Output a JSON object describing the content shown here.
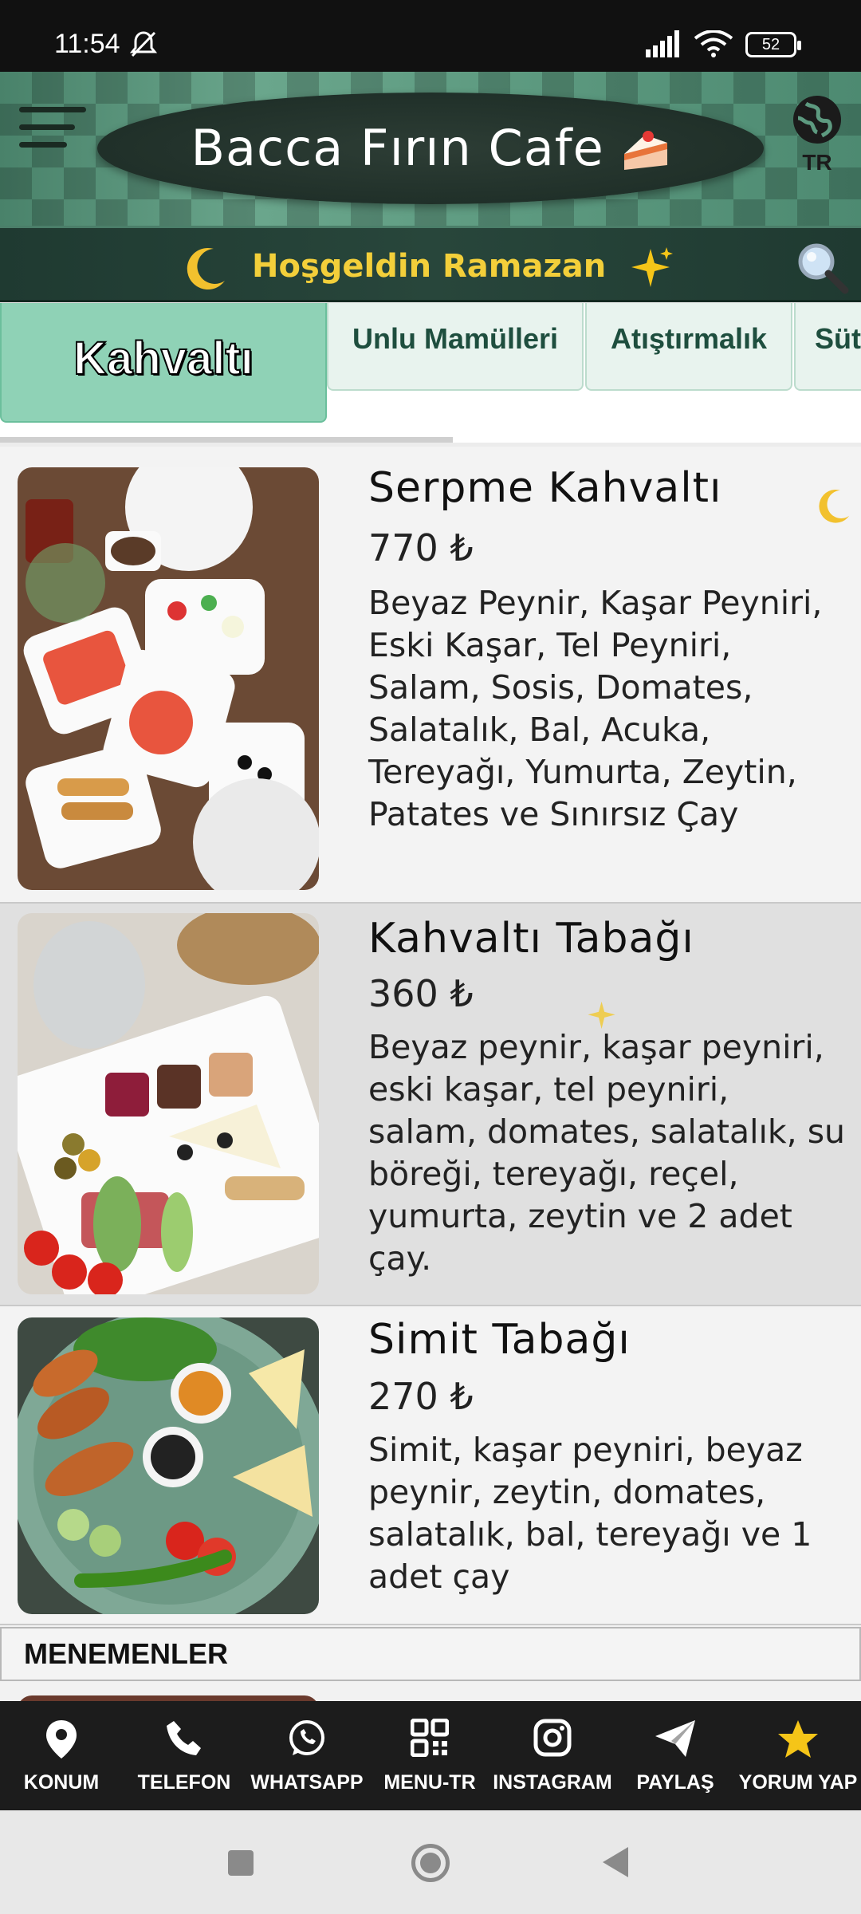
{
  "status_bar": {
    "time": "11:54",
    "battery": "52"
  },
  "header": {
    "title": "Bacca Fırın Cafe",
    "language": "TR"
  },
  "banner": {
    "text": "Hoşgeldin Ramazan"
  },
  "tabs": [
    {
      "label": "Kahvaltı",
      "active": true
    },
    {
      "label": "Unlu Mamülleri"
    },
    {
      "label": "Atıştırmalık"
    },
    {
      "label": "Süt"
    }
  ],
  "menu_items": [
    {
      "name": "Serpme Kahvaltı",
      "price": "770 ₺",
      "description": "Beyaz Peynir, Kaşar Peyniri, Eski Kaşar, Tel Peyniri, Salam, Sosis, Domates, Salatalık, Bal, Acuka, Tereyağı, Yumurta, Zeytin, Patates ve Sınırsız Çay"
    },
    {
      "name": "Kahvaltı Tabağı",
      "price": "360 ₺",
      "description": "Beyaz peynir, kaşar peyniri, eski kaşar, tel peyniri, salam, domates, salatalık, su böreği, tereyağı, reçel, yumurta, zeytin ve 2 adet çay."
    },
    {
      "name": "Simit Tabağı",
      "price": "270 ₺",
      "description": "Simit, kaşar peyniri, beyaz peynir, zeytin, domates, salatalık, bal, tereyağı ve 1 adet çay"
    }
  ],
  "section_heading": "MENEMENLER",
  "bottom_nav": [
    {
      "label": "KONUM",
      "icon": "location-pin-icon"
    },
    {
      "label": "TELEFON",
      "icon": "phone-icon"
    },
    {
      "label": "WHATSAPP",
      "icon": "whatsapp-icon"
    },
    {
      "label": "MENU-TR",
      "icon": "qr-code-icon"
    },
    {
      "label": "INSTAGRAM",
      "icon": "instagram-icon"
    },
    {
      "label": "PAYLAŞ",
      "icon": "share-icon"
    },
    {
      "label": "YORUM YAP",
      "icon": "star-icon"
    }
  ],
  "colors": {
    "accent": "#8fd2b6",
    "header": "#5d9a80",
    "banner_text": "#f3cf3a",
    "nav_bg": "#1c1c1c"
  }
}
